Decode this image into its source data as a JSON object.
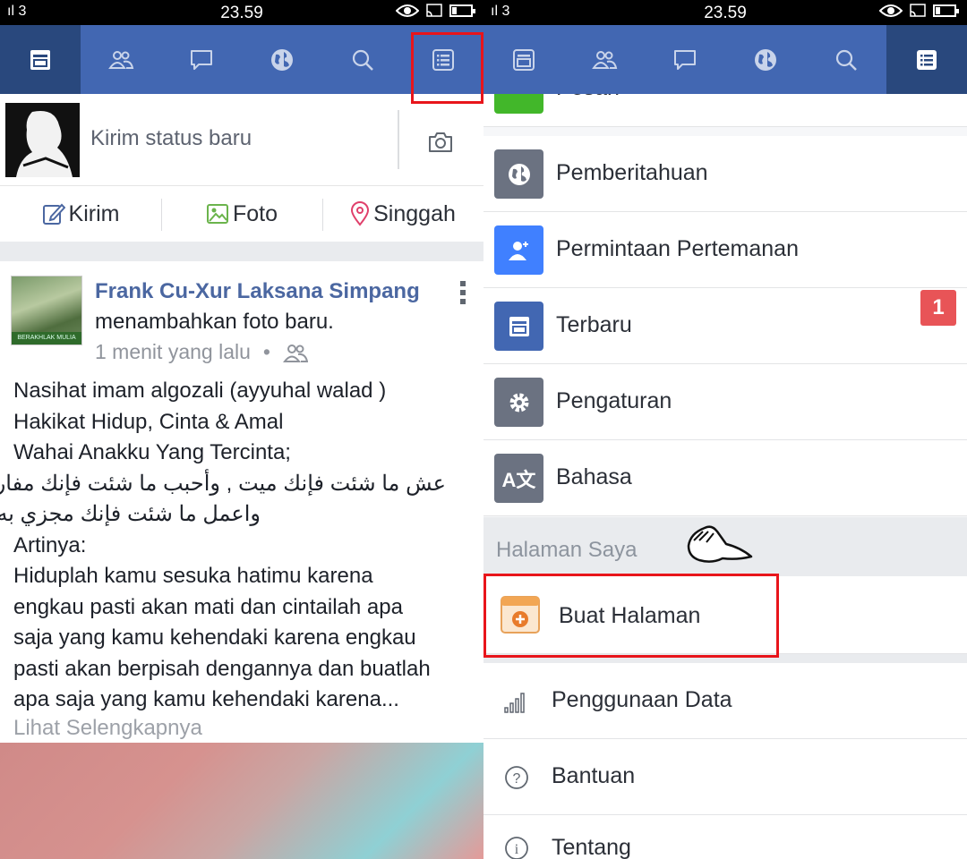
{
  "status_bar": {
    "signal": "ıl 3",
    "time": "23.59"
  },
  "left": {
    "composer": {
      "placeholder": "Kirim status baru"
    },
    "actions": [
      {
        "label": "Kirim"
      },
      {
        "label": "Foto"
      },
      {
        "label": "Singgah"
      }
    ],
    "post": {
      "author": "Frank Cu-Xur Laksana Simpang",
      "action": "menambahkan foto baru.",
      "time": "1 menit yang lalu",
      "avatar_caption": "BERAKHLAK MULIA",
      "body_lines": [
        "Nasihat imam algozali (ayyuhal walad )",
        "Hakikat Hidup, Cinta & Amal",
        "Wahai Anakku Yang Tercinta;",
        "عش ما شئت فإنك ميت , وأحبب ما شئت فإنك مفارقه ,",
        "واعمل ما شئت فإنك مجزي به .",
        "Artinya:",
        "Hiduplah kamu sesuka hatimu karena",
        "engkau pasti akan mati dan cintailah apa",
        "saja yang kamu kehendaki karena engkau",
        "pasti akan berpisah dengannya dan buatlah",
        "apa saja yang kamu kehendaki karena..."
      ],
      "see_more": "Lihat Selengkapnya"
    }
  },
  "right": {
    "menu": [
      {
        "label": "Pesan",
        "icon": "chat-icon",
        "color": "#42b72a"
      },
      {
        "label": "Pemberitahuan",
        "icon": "globe-icon",
        "color": "#6b7281"
      },
      {
        "label": "Permintaan Pertemanan",
        "icon": "add-friend-icon",
        "color": "#4080ff"
      },
      {
        "label": "Terbaru",
        "icon": "feed-icon",
        "color": "#4267b2"
      },
      {
        "label": "Pengaturan",
        "icon": "gear-icon",
        "color": "#6b7281",
        "badge": "1"
      },
      {
        "label": "Bahasa",
        "icon": "translate-icon",
        "color": "#6b7281"
      }
    ],
    "section_title": "Halaman Saya",
    "create_page": "Buat Halaman",
    "extra": [
      {
        "label": "Penggunaan Data",
        "icon": "signal-bars-icon"
      },
      {
        "label": "Bantuan",
        "icon": "help-icon"
      },
      {
        "label": "Tentang",
        "icon": "info-icon"
      }
    ]
  },
  "colors": {
    "brand": "#4267b2",
    "active_tab": "#29487d",
    "highlight": "#e8151b"
  }
}
